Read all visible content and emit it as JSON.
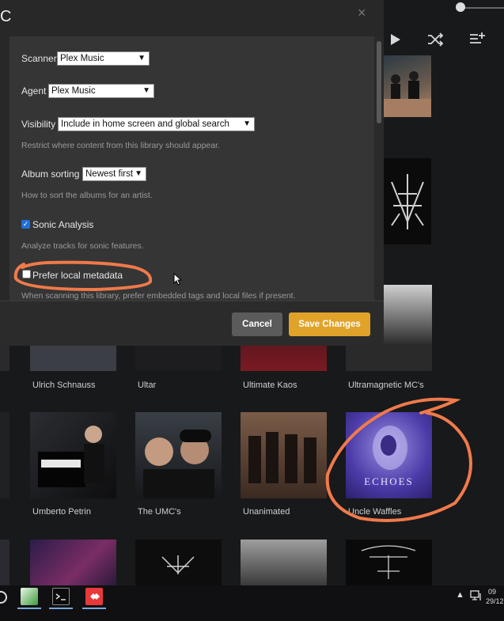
{
  "modal": {
    "title_fragment": "C",
    "close_label": "×",
    "fields": {
      "scanner": {
        "label": "Scanner",
        "value": "Plex Music"
      },
      "agent": {
        "label": "Agent",
        "value": "Plex Music"
      },
      "visibility": {
        "label": "Visibility",
        "value": "Include in home screen and global search",
        "help": "Restrict where content from this library should appear."
      },
      "album_sorting": {
        "label": "Album sorting",
        "value": "Newest first",
        "help": "How to sort the albums for an artist."
      },
      "sonic_analysis": {
        "label": "Sonic Analysis",
        "checked": true,
        "help": "Analyze tracks for sonic features."
      },
      "prefer_local": {
        "label": "Prefer local metadata",
        "checked": false,
        "help": "When scanning this library, prefer embedded tags and local files if present."
      }
    },
    "buttons": {
      "cancel": "Cancel",
      "save": "Save Changes"
    }
  },
  "library": {
    "row1": [
      "Ulrich Schnauss",
      "Ultar",
      "Ultimate Kaos",
      "Ultramagnetic MC's"
    ],
    "row2": [
      "Umberto Petrin",
      "The UMC's",
      "Unanimated",
      "Uncle Waffles"
    ],
    "album_text": "ECHOES"
  },
  "taskbar": {
    "time": "09",
    "date": "29/12"
  },
  "colors": {
    "accent": "#e0a329",
    "annotation": "#f07a4a",
    "checkbox": "#1e6fd8"
  }
}
